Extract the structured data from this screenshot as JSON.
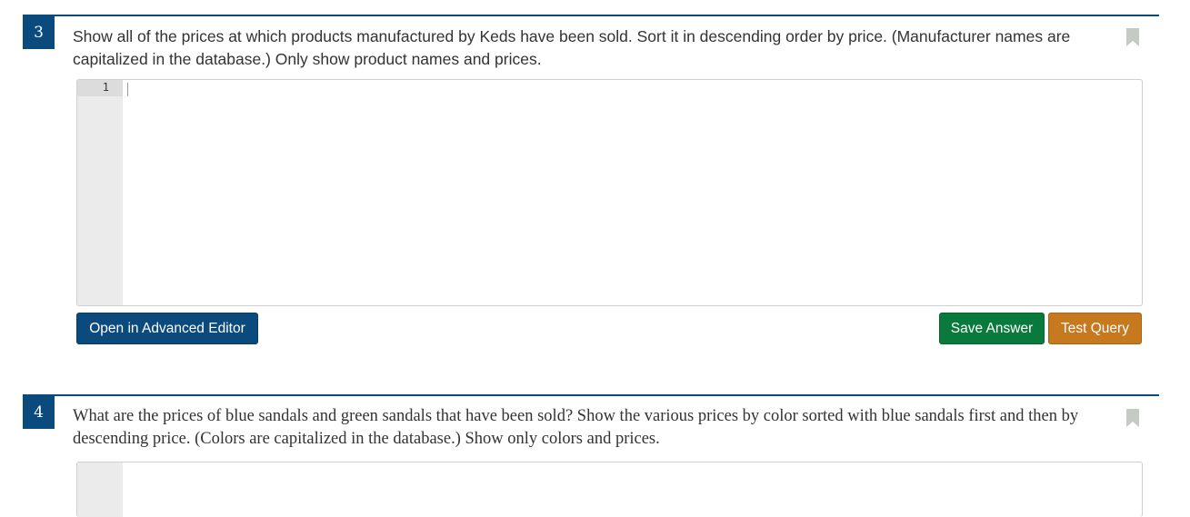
{
  "questions": [
    {
      "number": "3",
      "text": "Show all of the prices at which products manufactured by Keds have been sold. Sort it in descending order by price. (Manufacturer names are capitalized in the database.) Only show product names and prices.",
      "editor": {
        "line_number": "1",
        "content": ""
      },
      "buttons": {
        "advanced_editor": "Open in Advanced Editor",
        "save_answer": "Save Answer",
        "test_query": "Test Query"
      }
    },
    {
      "number": "4",
      "text": "What are the prices of blue sandals and green sandals that have been sold? Show the various prices by color sorted with blue sandals first and then by descending price. (Colors are capitalized in the database.) Show only colors and prices."
    }
  ],
  "colors": {
    "primary": "#0b4a7d",
    "save": "#0a7a3c",
    "test": "#c7791f",
    "bookmark": "#c4cbc5"
  },
  "icons": {
    "bookmark": "bookmark-icon"
  }
}
